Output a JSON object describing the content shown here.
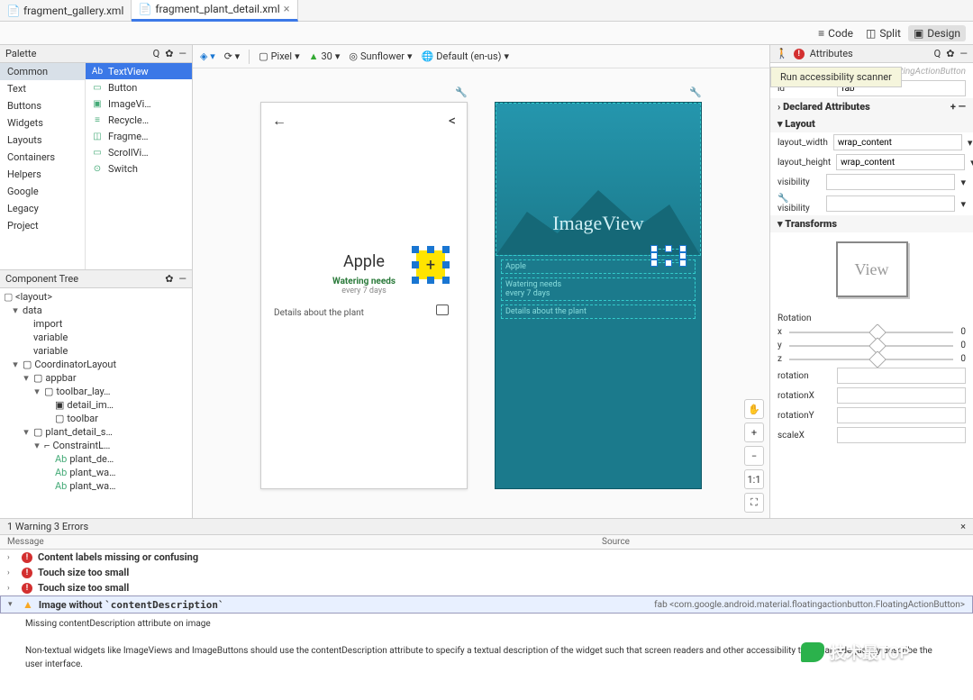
{
  "tabs": {
    "t0": "fragment_gallery.xml",
    "t1": "fragment_plant_detail.xml"
  },
  "modes": {
    "code": "Code",
    "split": "Split",
    "design": "Design"
  },
  "palette": {
    "title": "Palette",
    "cats": {
      "common": "Common",
      "text": "Text",
      "buttons": "Buttons",
      "widgets": "Widgets",
      "layouts": "Layouts",
      "containers": "Containers",
      "helpers": "Helpers",
      "google": "Google",
      "legacy": "Legacy",
      "project": "Project"
    },
    "items": {
      "tv": "TextView",
      "btn": "Button",
      "iv": "ImageVi…",
      "rv": "Recycle…",
      "fr": "Fragme…",
      "sv": "ScrollVi…",
      "sw": "Switch"
    }
  },
  "comptree": {
    "title": "Component Tree",
    "layout": "<layout>",
    "data": "data",
    "import": "import",
    "var1": "variable",
    "var2": "variable",
    "coord": "CoordinatorLayout",
    "appbar": "appbar",
    "toolbarlay": "toolbar_lay…",
    "detailim": "detail_im…",
    "toolbar": "toolbar",
    "plantdet": "plant_detail_s…",
    "constr": "ConstraintL…",
    "pd1": "plant_de…",
    "pd2": "plant_wa…",
    "pd3": "plant_wa…"
  },
  "devtoolbar": {
    "device": "Pixel",
    "api": "30",
    "theme": "Sunflower",
    "locale": "Default (en-us)"
  },
  "preview": {
    "plant_name": "Apple",
    "water_label": "Watering needs",
    "water_days": "every 7 days",
    "details": "Details about the plant",
    "imgview": "ImageView",
    "bp_apple": "Apple",
    "bp_water": "Watering needs",
    "bp_days": "every 7 days",
    "bp_details": "Details about the plant"
  },
  "canvas_ctrl": {
    "hand": "✋",
    "plus": "+",
    "minus": "−",
    "ratio": "1:1",
    "expand": "⛶"
  },
  "attrs": {
    "title": "Attributes",
    "tooltip": "Run accessibility scanner",
    "type": "FloatingActionButton",
    "id_label": "id",
    "id_val": "fab",
    "declared": "Declared Attributes",
    "layout": "Layout",
    "lw_label": "layout_width",
    "lw_val": "wrap_content",
    "lh_label": "layout_height",
    "lh_val": "wrap_content",
    "vis_label": "visibility",
    "tvis_label": "visibility",
    "transforms": "Transforms",
    "view": "View",
    "rotation": "Rotation",
    "x": "x",
    "y": "y",
    "z": "z",
    "v0": "0",
    "rot_label": "rotation",
    "rotx_label": "rotationX",
    "roty_label": "rotationY",
    "sx_label": "scaleX"
  },
  "problems": {
    "summary": "1 Warning 3 Errors",
    "msg": "Message",
    "src": "Source",
    "i0": "Content labels missing or confusing",
    "i1": "Touch size too small",
    "i2": "Touch size too small",
    "i3": "Image without `contentDescription`",
    "i3_src": "fab <com.google.android.material.floatingactionbutton.FloatingActionButton>",
    "d1": "Missing contentDescription attribute on image",
    "d2": "Non-textual widgets like ImageViews and ImageButtons should use the contentDescription attribute to specify a textual description of the widget such that screen readers and other accessibility tools can adequately describe the user interface."
  },
  "watermark": "技术最TOP"
}
